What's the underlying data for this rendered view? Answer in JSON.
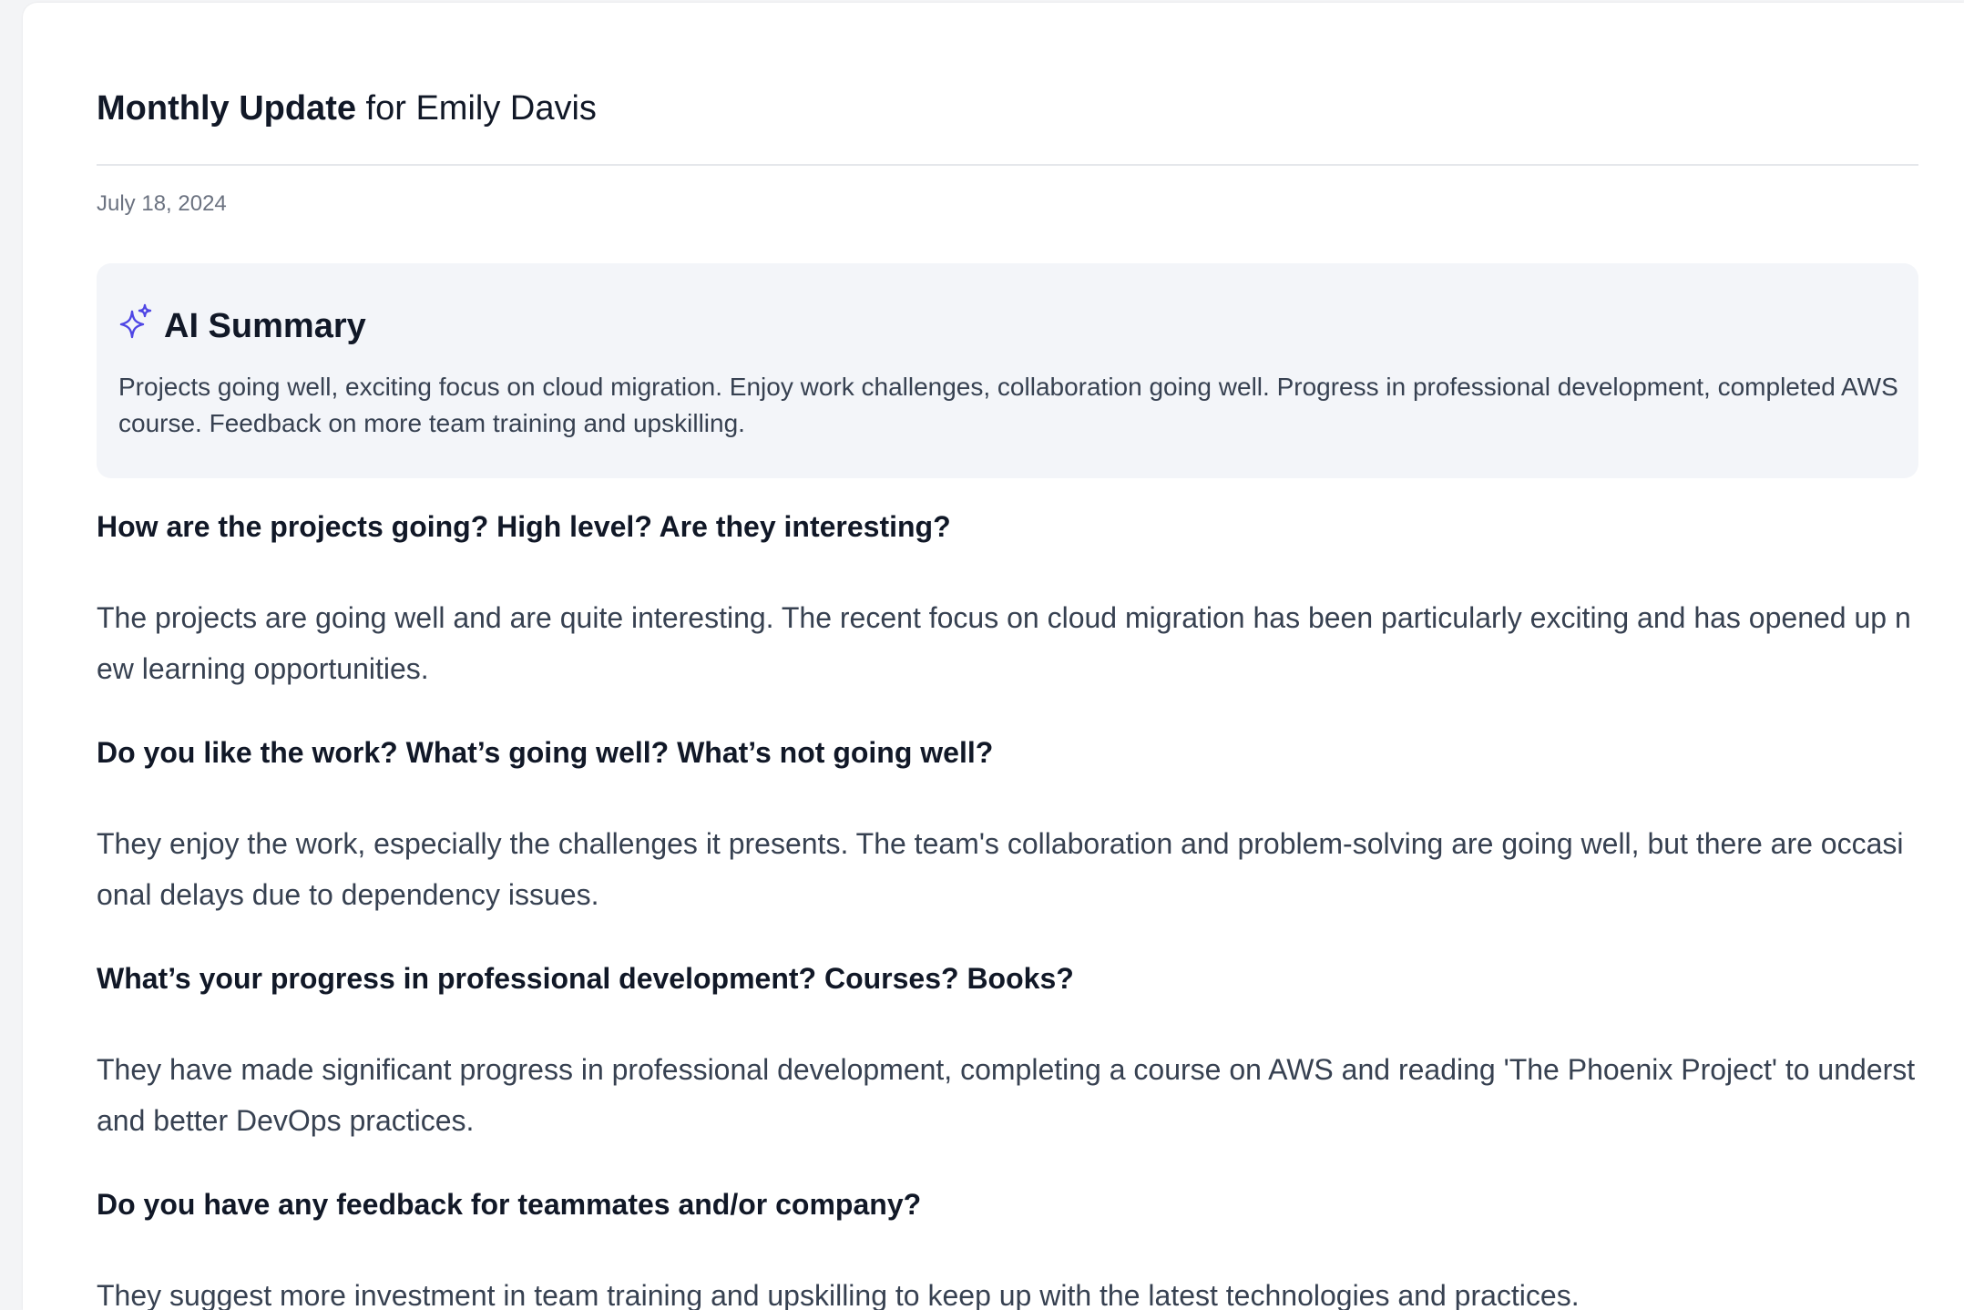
{
  "header": {
    "title_strong": "Monthly Update",
    "title_rest": " for Emily Davis",
    "date": "July 18, 2024"
  },
  "summary": {
    "icon": "sparkles-icon",
    "title": "AI Summary",
    "text": "Projects going well, exciting focus on cloud migration. Enjoy work challenges, collaboration going well. Progress in professional development, completed AWS course. Feedback on more team training and upskilling."
  },
  "qa": [
    {
      "question": "How are the projects going? High level? Are they interesting?",
      "answer": "The projects are going well and are quite interesting. The recent focus on cloud migration has been particularly exciting and has opened up new learning opportunities."
    },
    {
      "question": "Do you like the work? What’s going well? What’s not going well?",
      "answer": "They enjoy the work, especially the challenges it presents. The team's collaboration and problem-solving are going well, but there are occasional delays due to dependency issues."
    },
    {
      "question": "What’s your progress in professional development? Courses? Books?",
      "answer": "They have made significant progress in professional development, completing a course on AWS and reading 'The Phoenix Project' to understand better DevOps practices."
    },
    {
      "question": "Do you have any feedback for teammates and/or company?",
      "answer": "They suggest more investment in team training and upskilling to keep up with the latest technologies and practices."
    }
  ],
  "colors": {
    "accent": "#4f46e5",
    "summary_bg": "#f3f5f9"
  }
}
